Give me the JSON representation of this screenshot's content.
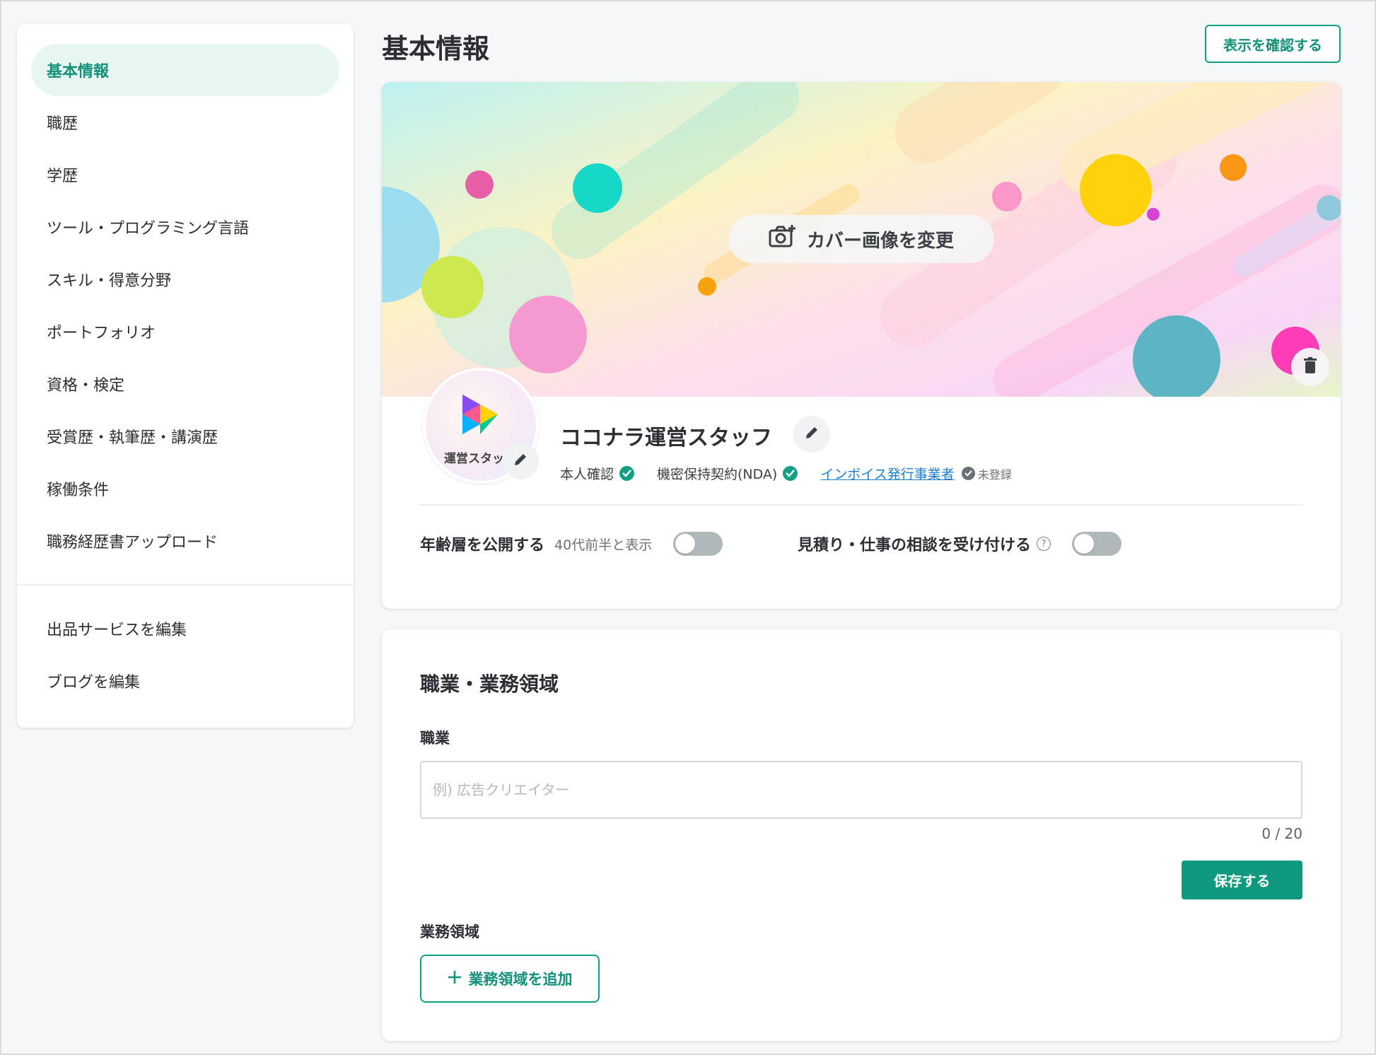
{
  "sidebar": {
    "items": [
      {
        "label": "基本情報",
        "active": true
      },
      {
        "label": "職歴"
      },
      {
        "label": "学歴"
      },
      {
        "label": "ツール・プログラミング言語"
      },
      {
        "label": "スキル・得意分野"
      },
      {
        "label": "ポートフォリオ"
      },
      {
        "label": "資格・検定"
      },
      {
        "label": "受賞歴・執筆歴・講演歴"
      },
      {
        "label": "稼働条件"
      },
      {
        "label": "職務経歴書アップロード"
      }
    ],
    "secondary_items": [
      {
        "label": "出品サービスを編集"
      },
      {
        "label": "ブログを編集"
      }
    ]
  },
  "header": {
    "title": "基本情報",
    "preview_button": "表示を確認する"
  },
  "cover": {
    "change_button": "カバー画像を変更",
    "camera_icon": "camera-add-icon",
    "delete_icon": "trash-icon"
  },
  "profile": {
    "avatar_text": "運営スタッ",
    "name": "ココナラ運営スタッフ",
    "badges": {
      "identity": "本人確認",
      "nda": "機密保持契約(NDA)",
      "invoice_link": "インボイス発行事業者",
      "invoice_status": "未登録"
    }
  },
  "settings": {
    "age_label": "年齢層を公開する",
    "age_sub": "40代前半と表示",
    "age_toggle_on": false,
    "consult_label": "見積り・仕事の相談を受け付ける",
    "consult_toggle_on": false
  },
  "occupation": {
    "section_title": "職業・業務領域",
    "job_label": "職業",
    "job_value": "",
    "job_placeholder": "例) 広告クリエイター",
    "counter": "0 / 20",
    "save_button": "保存する",
    "domain_label": "業務領域",
    "add_domain_button": "業務領域を追加"
  },
  "colors": {
    "accent": "#12a085",
    "accent_text": "#12907a",
    "active_bg": "#e8f6f2",
    "link": "#1f7fd1"
  }
}
